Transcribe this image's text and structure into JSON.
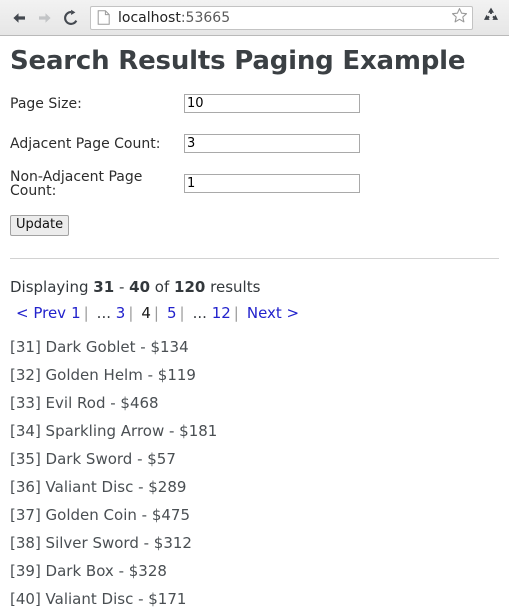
{
  "browser": {
    "back_icon": "back-arrow-icon",
    "forward_icon": "forward-arrow-icon",
    "reload_icon": "reload-icon",
    "page_icon": "page-document-icon",
    "url_host": "localhost",
    "url_port": ":53665",
    "url_full": "localhost:53665",
    "bookmark_icon": "star-icon",
    "extension_icon": "recycle-icon"
  },
  "page": {
    "title": "Search Results Paging Example",
    "form": {
      "fields": [
        {
          "label": "Page Size:",
          "value": "10",
          "name": "page-size"
        },
        {
          "label": "Adjacent Page Count:",
          "value": "3",
          "name": "adjacent-page-count"
        },
        {
          "label": "Non-Adjacent Page Count:",
          "value": "1",
          "name": "non-adjacent-page-count"
        }
      ],
      "submit_label": "Update"
    },
    "summary": {
      "prefix": "Displaying",
      "from": "31",
      "dash": "-",
      "to": "40",
      "middle": "of",
      "total": "120",
      "suffix": "results"
    },
    "pager": {
      "prev_label": "< Prev",
      "next_label": "Next >",
      "ellipsis": "...",
      "separator": "|",
      "pages": [
        {
          "label": "1",
          "current": false
        },
        {
          "label": "3",
          "current": false
        },
        {
          "label": "4",
          "current": true
        },
        {
          "label": "5",
          "current": false
        },
        {
          "label": "12",
          "current": false
        }
      ],
      "link_color": "#2222cc",
      "current_color": "#1a1a1a"
    },
    "results": [
      "[31] Dark Goblet - $134",
      "[32] Golden Helm - $119",
      "[33] Evil Rod - $468",
      "[34] Sparkling Arrow - $181",
      "[35] Dark Sword - $57",
      "[36] Valiant Disc - $289",
      "[37] Golden Coin - $475",
      "[38] Silver Sword - $312",
      "[39] Dark Box - $328",
      "[40] Valiant Disc - $171"
    ]
  }
}
